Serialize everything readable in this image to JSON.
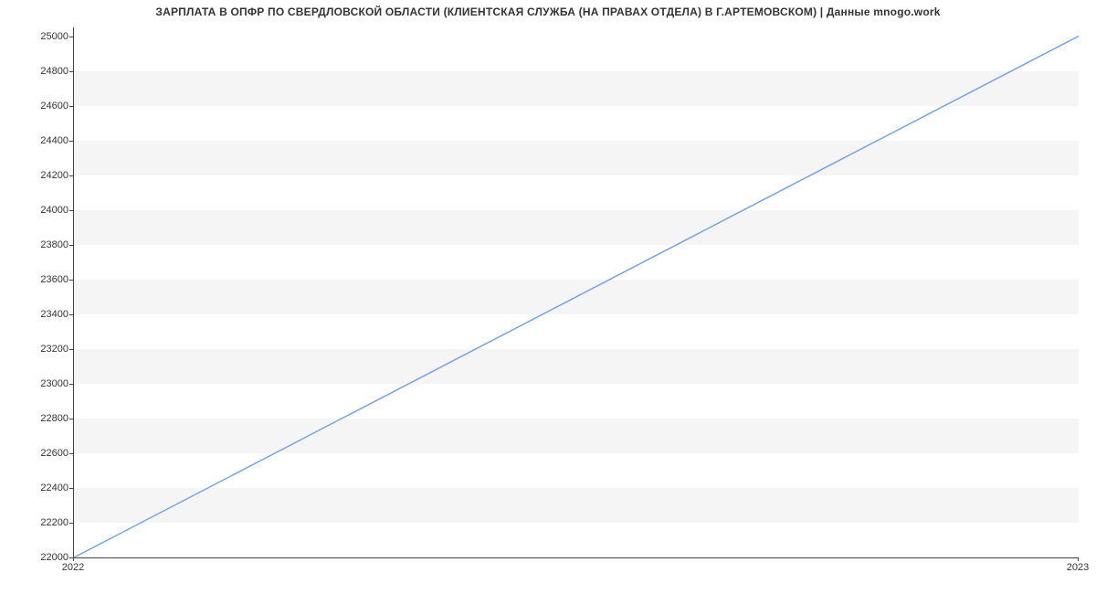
{
  "chart_data": {
    "type": "line",
    "title": "ЗАРПЛАТА В ОПФР ПО СВЕРДЛОВСКОЙ ОБЛАСТИ (КЛИЕНТСКАЯ СЛУЖБА (НА ПРАВАХ ОТДЕЛА) В Г.АРТЕМОВСКОМ) | Данные mnogo.work",
    "xlabel": "",
    "ylabel": "",
    "x": [
      "2022",
      "2023"
    ],
    "y": [
      22000,
      25000
    ],
    "y_ticks": [
      22000,
      22200,
      22400,
      22600,
      22800,
      23000,
      23200,
      23400,
      23600,
      23800,
      24000,
      24200,
      24400,
      24600,
      24800,
      25000
    ],
    "x_ticks": [
      "2022",
      "2023"
    ],
    "ylim": [
      22000,
      25050
    ],
    "line_color": "#6f9fe8"
  }
}
